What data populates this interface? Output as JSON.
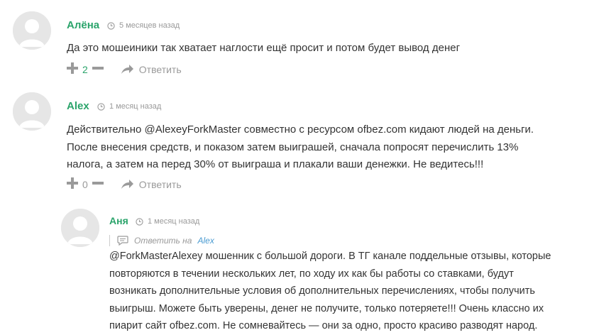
{
  "comments": [
    {
      "author": "Алёна",
      "time": "5 месяцев назад",
      "text": "Да это мошеиники так хватает наглости ещё просит и потом будет вывод денег",
      "votes": "2",
      "reply_label": "Ответить"
    },
    {
      "author": "Alex",
      "time": "1 месяц назад",
      "text_lines": [
        "Действительно @AlexeyForkMaster совместно с ресурсом ofbez.com кидают людей на деньги.",
        "После внесения средств, и показом затем выиграшей, сначала попросят перечислить 13%",
        "налога, а затем на перед 30% от выиграша и плакали ваши денежки. Не ведитесь!!!"
      ],
      "votes": "0",
      "reply_label": "Ответить"
    },
    {
      "author": "Аня",
      "time": "1 месяц назад",
      "reply_to_label": "Ответить на",
      "reply_to_target": "Alex",
      "text_lines": [
        "@ForkMasterAlexey мошенник с большой дороги. В ТГ канале поддельные отзывы, которые",
        "повторяются в течении нескольких лет, по ходу их как бы работы со ставками, будут",
        "возникать дополнительные условия об дополнительных перечислениях, чтобы получить",
        "выигрыш. Можете быть уверены, денег не получите, только потеряете!!! Очень классно их",
        "пиарит сайт ofbez.com. Не сомневайтесь — они за одно, просто красиво разводят народ."
      ]
    }
  ],
  "colors": {
    "author": "#2ba46b",
    "meta": "#9a9a9a",
    "link": "#4a9bd1"
  },
  "icons": [
    "avatar-placeholder-icon",
    "clock-icon",
    "plus-icon",
    "minus-icon",
    "reply-arrow-icon",
    "speech-bubble-icon"
  ]
}
